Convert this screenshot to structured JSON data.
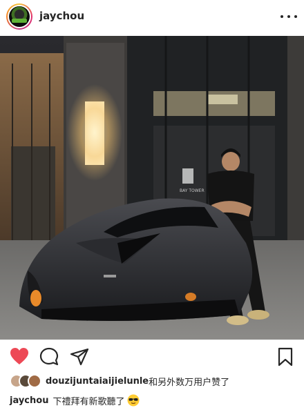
{
  "post": {
    "username": "jaychou",
    "avatar_icon": "profile-avatar-icon",
    "more_icon": "more-options-icon",
    "photo_description_icon": "sports-car-photo",
    "photo_sign": "BAY TOWER"
  },
  "actions": {
    "like_icon": "heart-filled-icon",
    "comment_icon": "comment-bubble-icon",
    "share_icon": "send-arrow-icon",
    "save_icon": "bookmark-icon",
    "like_color": "#ed4956"
  },
  "likes": {
    "first_user": "douzijuntaiaijielunle",
    "tail": "和另外数万用户赞了"
  },
  "caption": {
    "user": "jaychou",
    "text": "下禮拜有新歌聽了",
    "emoji": "sunglasses-emoji"
  }
}
